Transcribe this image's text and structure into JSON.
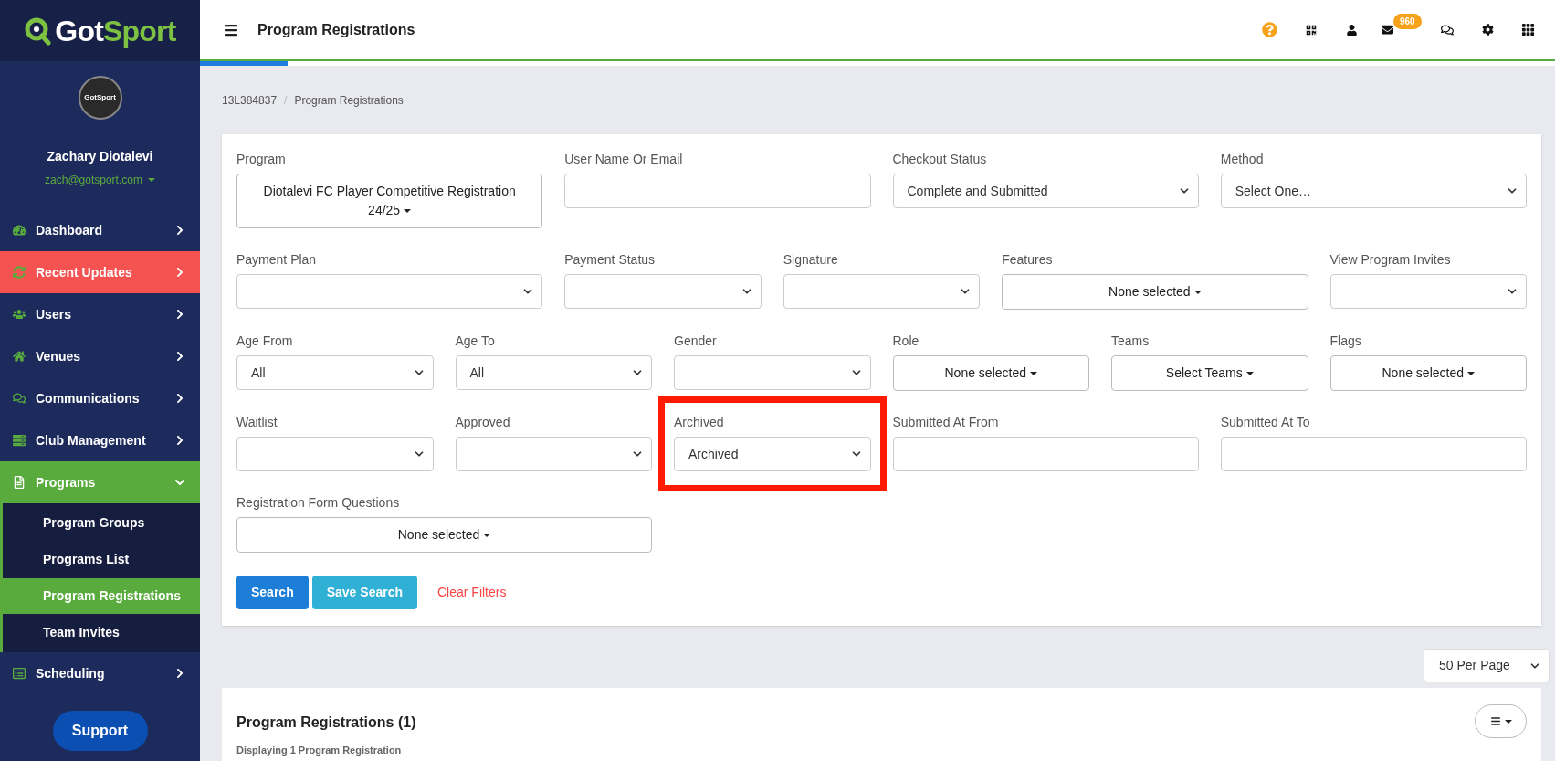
{
  "sidebar": {
    "logo": [
      "Got",
      "Sport"
    ],
    "avatar_text": "GotSport",
    "user_name": "Zachary Diotalevi",
    "user_email": "zach@gotsport.com",
    "items": [
      {
        "label": "Dashboard",
        "selected": false,
        "highlighted": false,
        "expanded": false
      },
      {
        "label": "Recent Updates",
        "selected": false,
        "highlighted": true,
        "expanded": false
      },
      {
        "label": "Users",
        "selected": false,
        "highlighted": false,
        "expanded": false
      },
      {
        "label": "Venues",
        "selected": false,
        "highlighted": false,
        "expanded": false
      },
      {
        "label": "Communications",
        "selected": false,
        "highlighted": false,
        "expanded": false
      },
      {
        "label": "Club Management",
        "selected": false,
        "highlighted": false,
        "expanded": false
      },
      {
        "label": "Programs",
        "selected": true,
        "highlighted": false,
        "expanded": true,
        "children": [
          {
            "label": "Program Groups",
            "selected": false
          },
          {
            "label": "Programs List",
            "selected": false
          },
          {
            "label": "Program Registrations",
            "selected": true
          },
          {
            "label": "Team Invites",
            "selected": false
          }
        ]
      },
      {
        "label": "Scheduling",
        "selected": false,
        "highlighted": false,
        "expanded": false
      }
    ],
    "support": "Support"
  },
  "header": {
    "title": "Program Registrations",
    "mail_badge": "960"
  },
  "loading": {
    "level": 0.065
  },
  "breadcrumb": [
    "13L384837",
    "Program Registrations"
  ],
  "breadcrumb_separator": "/",
  "filter_rows": [
    {
      "fields": [
        {
          "label": "Program",
          "kind": "multiselect",
          "value": "Diotalevi FC Player Competitive Registration 24/25",
          "highlighted": false
        },
        {
          "label": "User Name Or Email",
          "kind": "text",
          "highlighted": false
        },
        {
          "label": "Checkout Status",
          "kind": "select",
          "value": "Complete and Submitted",
          "highlighted": false
        },
        {
          "label": "Method",
          "kind": "select",
          "value": "Select One…",
          "highlighted": false
        }
      ]
    },
    {
      "fields": [
        {
          "label": "Payment Plan",
          "kind": "select",
          "highlighted": false
        },
        {
          "label": "Payment Status",
          "kind": "select",
          "highlighted": false
        },
        {
          "label": "Signature",
          "kind": "select",
          "highlighted": false
        },
        {
          "label": "Features",
          "kind": "multiselect",
          "value": "None selected",
          "highlighted": false
        },
        {
          "label": "View Program Invites",
          "kind": "select",
          "highlighted": false
        }
      ]
    },
    {
      "fields": [
        {
          "label": "Age From",
          "kind": "select",
          "value": "All",
          "highlighted": false
        },
        {
          "label": "Age To",
          "kind": "select",
          "value": "All",
          "highlighted": false
        },
        {
          "label": "Gender",
          "kind": "select",
          "highlighted": false
        },
        {
          "label": "Role",
          "kind": "multiselect",
          "value": "None selected",
          "highlighted": false
        },
        {
          "label": "Teams",
          "kind": "multiselect",
          "value": "Select Teams",
          "highlighted": false
        },
        {
          "label": "Flags",
          "kind": "multiselect",
          "value": "None selected",
          "highlighted": false
        }
      ]
    },
    {
      "fields": [
        {
          "label": "Waitlist",
          "kind": "select",
          "highlighted": false
        },
        {
          "label": "Approved",
          "kind": "select",
          "highlighted": false
        },
        {
          "label": "Archived",
          "kind": "select",
          "value": "Archived",
          "highlighted": true
        },
        {
          "label": "Submitted At From",
          "kind": "text",
          "highlighted": false
        },
        {
          "label": "Submitted At To",
          "kind": "text",
          "highlighted": false
        }
      ]
    },
    {
      "fields": [
        {
          "label": "Registration Form Questions",
          "kind": "multiselect",
          "value": "None selected",
          "highlighted": false
        }
      ]
    }
  ],
  "actions": [
    {
      "label": "Search",
      "kind": "primary"
    },
    {
      "label": "Save Search",
      "kind": "info"
    },
    {
      "label": "Clear Filters",
      "kind": "link"
    }
  ],
  "per_page": {
    "value": "50 Per Page"
  },
  "results": {
    "title": "Program Registrations (1)",
    "subtitle": "Displaying 1 Program Registration"
  }
}
